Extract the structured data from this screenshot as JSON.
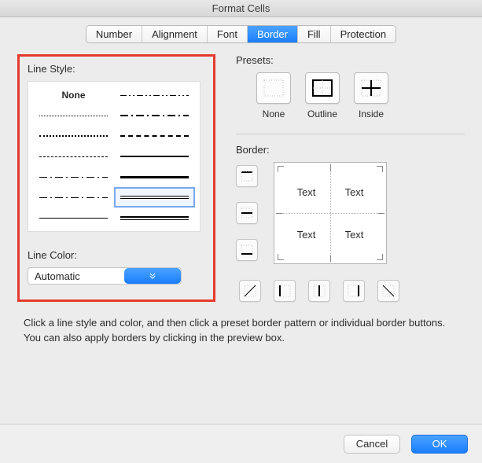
{
  "window": {
    "title": "Format Cells"
  },
  "tabs": {
    "items": [
      "Number",
      "Alignment",
      "Font",
      "Border",
      "Fill",
      "Protection"
    ],
    "active_index": 3
  },
  "left": {
    "line_style_label": "Line Style:",
    "none_label": "None",
    "line_color_label": "Line Color:",
    "line_color_value": "Automatic"
  },
  "right": {
    "presets_label": "Presets:",
    "presets": [
      "None",
      "Outline",
      "Inside"
    ],
    "border_label": "Border:",
    "preview_text": "Text"
  },
  "note": "Click a line style and color, and then click a preset border pattern or individual border buttons. You can also apply borders by clicking in the preview box.",
  "footer": {
    "cancel": "Cancel",
    "ok": "OK"
  },
  "colors": {
    "highlight": "#e63a2f",
    "accent": "#1a7efc"
  }
}
